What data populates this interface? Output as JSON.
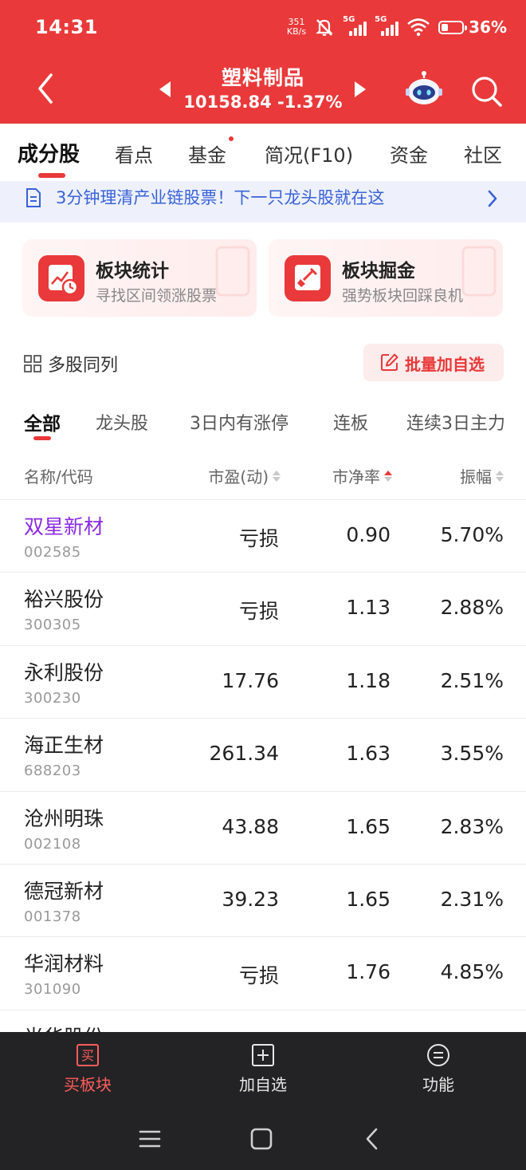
{
  "status_bar": {
    "time": "14:31",
    "net_speed_value": "351",
    "net_speed_unit": "KB/s",
    "sim1": "5G",
    "sim2": "5G",
    "battery": "36%"
  },
  "header": {
    "title": "塑料制品",
    "index_line": "10158.84 -1.37%",
    "bg_color": "#e9393a"
  },
  "tabs": [
    {
      "label": "成分股",
      "active": true
    },
    {
      "label": "看点"
    },
    {
      "label": "基金",
      "dot": true
    },
    {
      "label": "简况(F10)"
    },
    {
      "label": "资金"
    },
    {
      "label": "社区"
    }
  ],
  "promo": {
    "text": "3分钟理清产业链股票！下一只龙头股就在这"
  },
  "cards": [
    {
      "title": "板块统计",
      "subtitle": "寻找区间领涨股票"
    },
    {
      "title": "板块掘金",
      "subtitle": "强势板块回踩良机"
    }
  ],
  "actions": {
    "multi_label": "多股同列",
    "batch_label": "批量加自选"
  },
  "subtabs": [
    {
      "label": "全部",
      "active": true
    },
    {
      "label": "龙头股"
    },
    {
      "label": "3日内有涨停"
    },
    {
      "label": "连板"
    },
    {
      "label": "连续3日主力"
    }
  ],
  "table": {
    "headers": {
      "name": "名称/代码",
      "pe": "市盈(动)",
      "pb": "市净率",
      "amplitude": "振幅"
    },
    "rows": [
      {
        "name": "双星新材",
        "code": "002585",
        "pe": "亏损",
        "pb": "0.90",
        "amp": "5.70%",
        "visited": true
      },
      {
        "name": "裕兴股份",
        "code": "300305",
        "pe": "亏损",
        "pb": "1.13",
        "amp": "2.88%"
      },
      {
        "name": "永利股份",
        "code": "300230",
        "pe": "17.76",
        "pb": "1.18",
        "amp": "2.51%"
      },
      {
        "name": "海正生材",
        "code": "688203",
        "pe": "261.34",
        "pb": "1.63",
        "amp": "3.55%"
      },
      {
        "name": "沧州明珠",
        "code": "002108",
        "pe": "43.88",
        "pb": "1.65",
        "amp": "2.83%"
      },
      {
        "name": "德冠新材",
        "code": "001378",
        "pe": "39.23",
        "pb": "1.65",
        "amp": "2.31%"
      },
      {
        "name": "华润材料",
        "code": "301090",
        "pe": "亏损",
        "pb": "1.76",
        "amp": "4.85%"
      },
      {
        "name": "光华股份",
        "code": "",
        "pe": "",
        "pb": "",
        "amp": ""
      }
    ]
  },
  "toolbar": {
    "buy_icon_char": "买",
    "buy_label": "买板块",
    "add_label": "加自选",
    "func_label": "功能"
  }
}
